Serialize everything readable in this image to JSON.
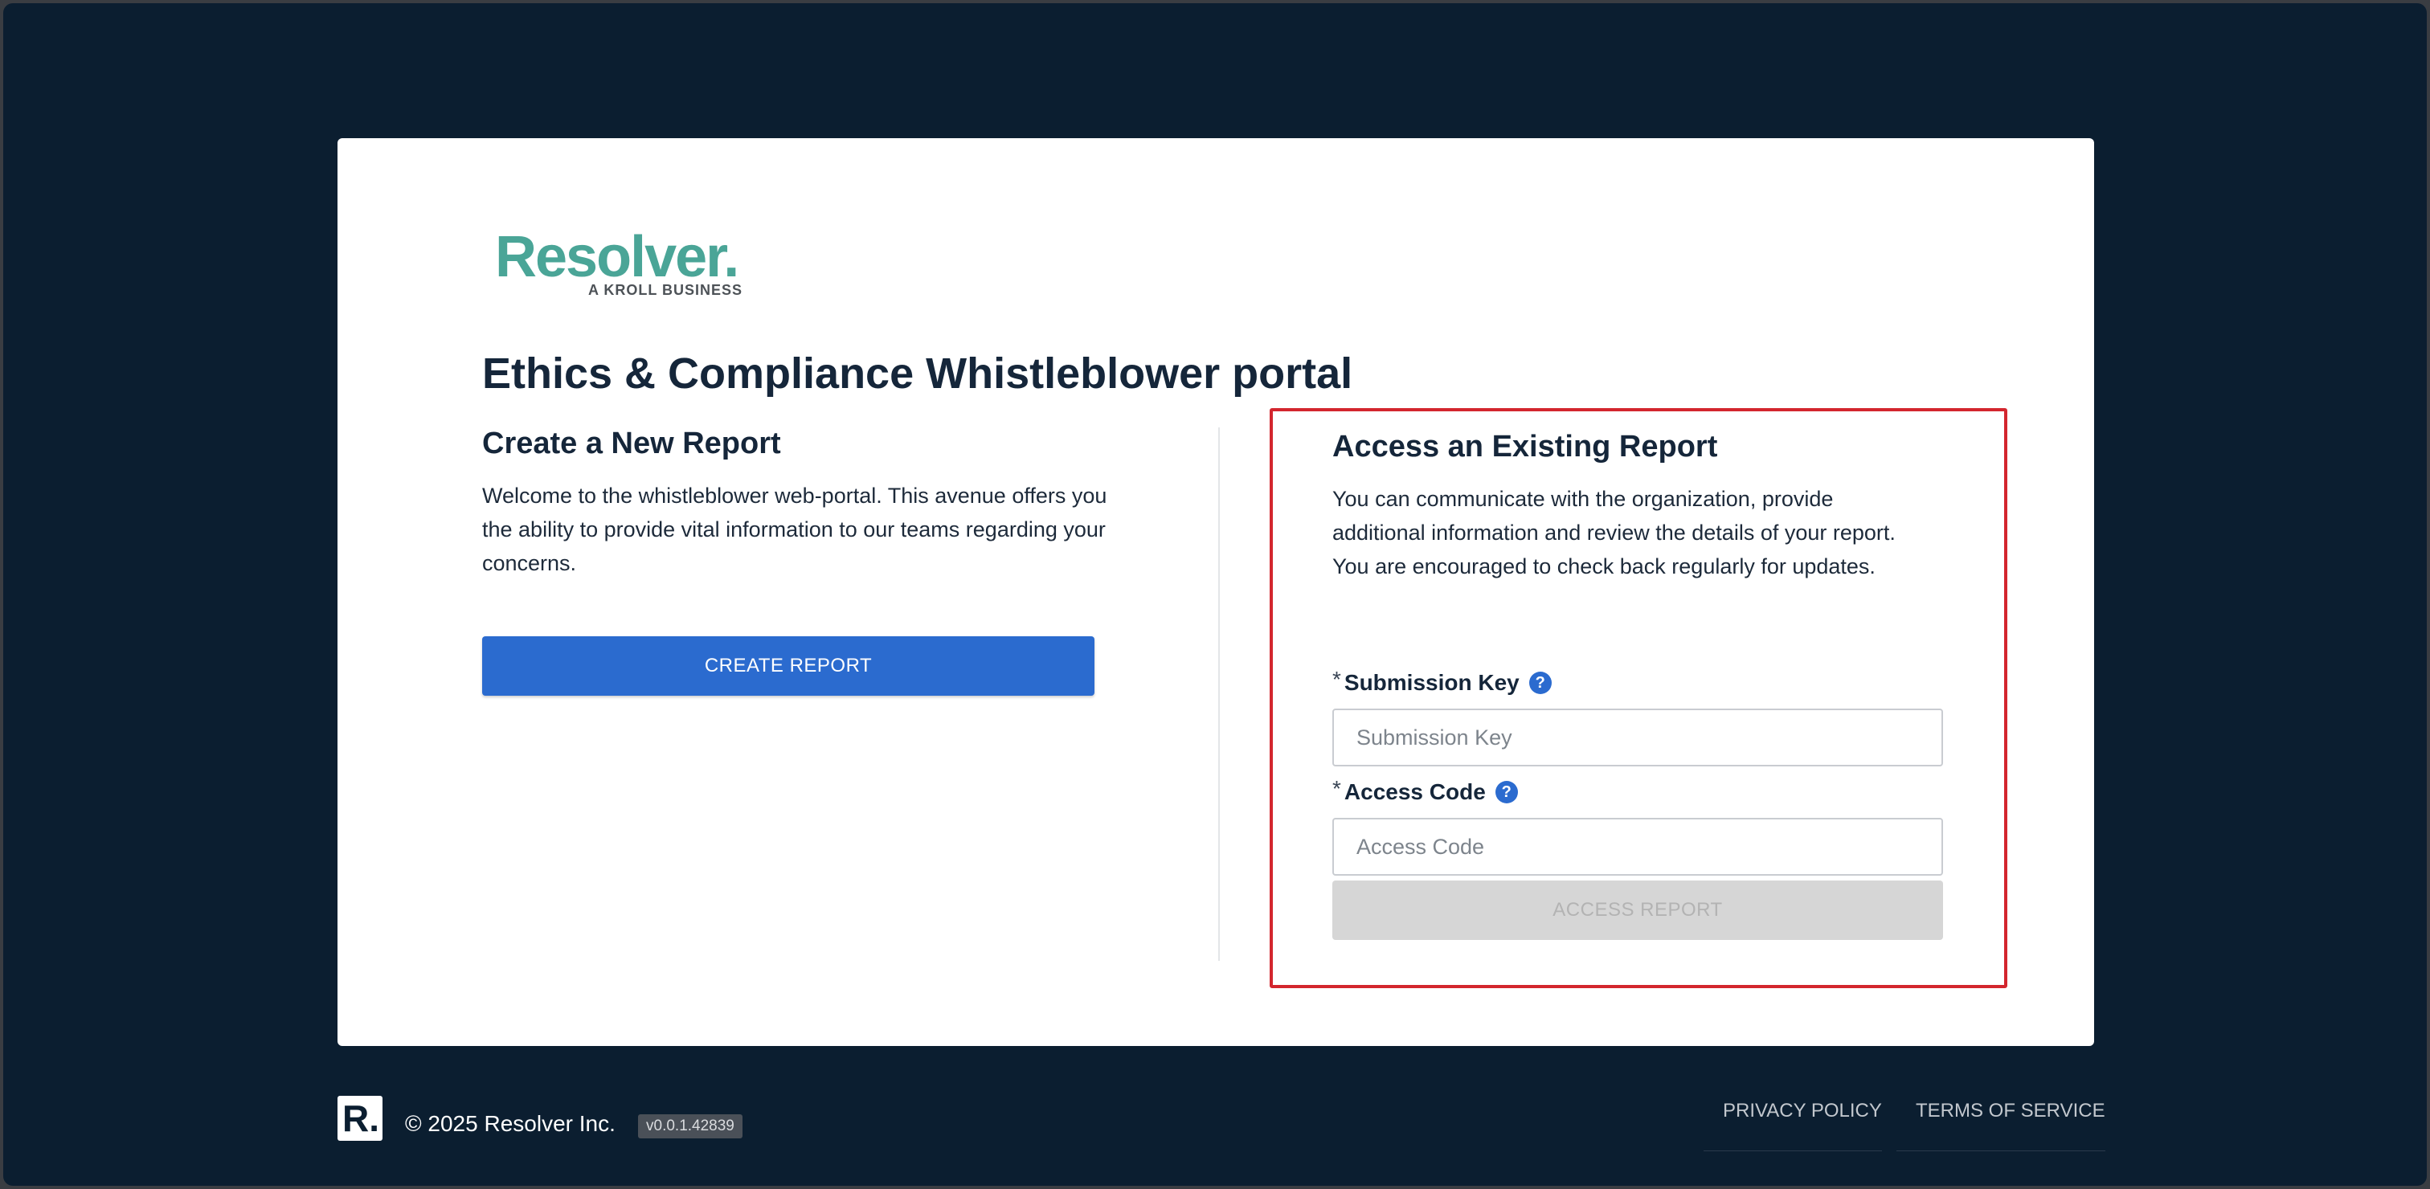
{
  "logo": {
    "wordmark": "Resolver.",
    "tagline": "A KROLL BUSINESS"
  },
  "page_title": "Ethics & Compliance Whistleblower portal",
  "create_section": {
    "title": "Create a New Report",
    "description": "Welcome to the whistleblower web-portal. This avenue offers you the ability to provide vital information to our teams regarding your concerns.",
    "button_label": "CREATE REPORT"
  },
  "access_section": {
    "title": "Access an Existing Report",
    "description_lines": [
      "You can communicate with the organization, provide",
      "additional information and review the details of your report.",
      "You are encouraged to check back regularly for updates."
    ],
    "submission_key": {
      "required_marker": "*",
      "label": "Submission Key",
      "help_glyph": "?",
      "placeholder": "Submission Key",
      "value": ""
    },
    "access_code": {
      "required_marker": "*",
      "label": "Access Code",
      "help_glyph": "?",
      "placeholder": "Access Code",
      "value": ""
    },
    "button_label": "ACCESS REPORT",
    "button_state": "disabled",
    "highlight_color": "#d3262e"
  },
  "footer": {
    "logo_glyph": "R.",
    "copyright": "© 2025 Resolver Inc.",
    "version": "v0.0.1.42839",
    "links": [
      "PRIVACY POLICY",
      "TERMS OF SERVICE"
    ]
  },
  "colors": {
    "background": "#0b1e30",
    "card": "#ffffff",
    "brand_teal": "#4aa597",
    "primary_button": "#2b6bcf",
    "disabled_button": "#d6d6d6"
  }
}
